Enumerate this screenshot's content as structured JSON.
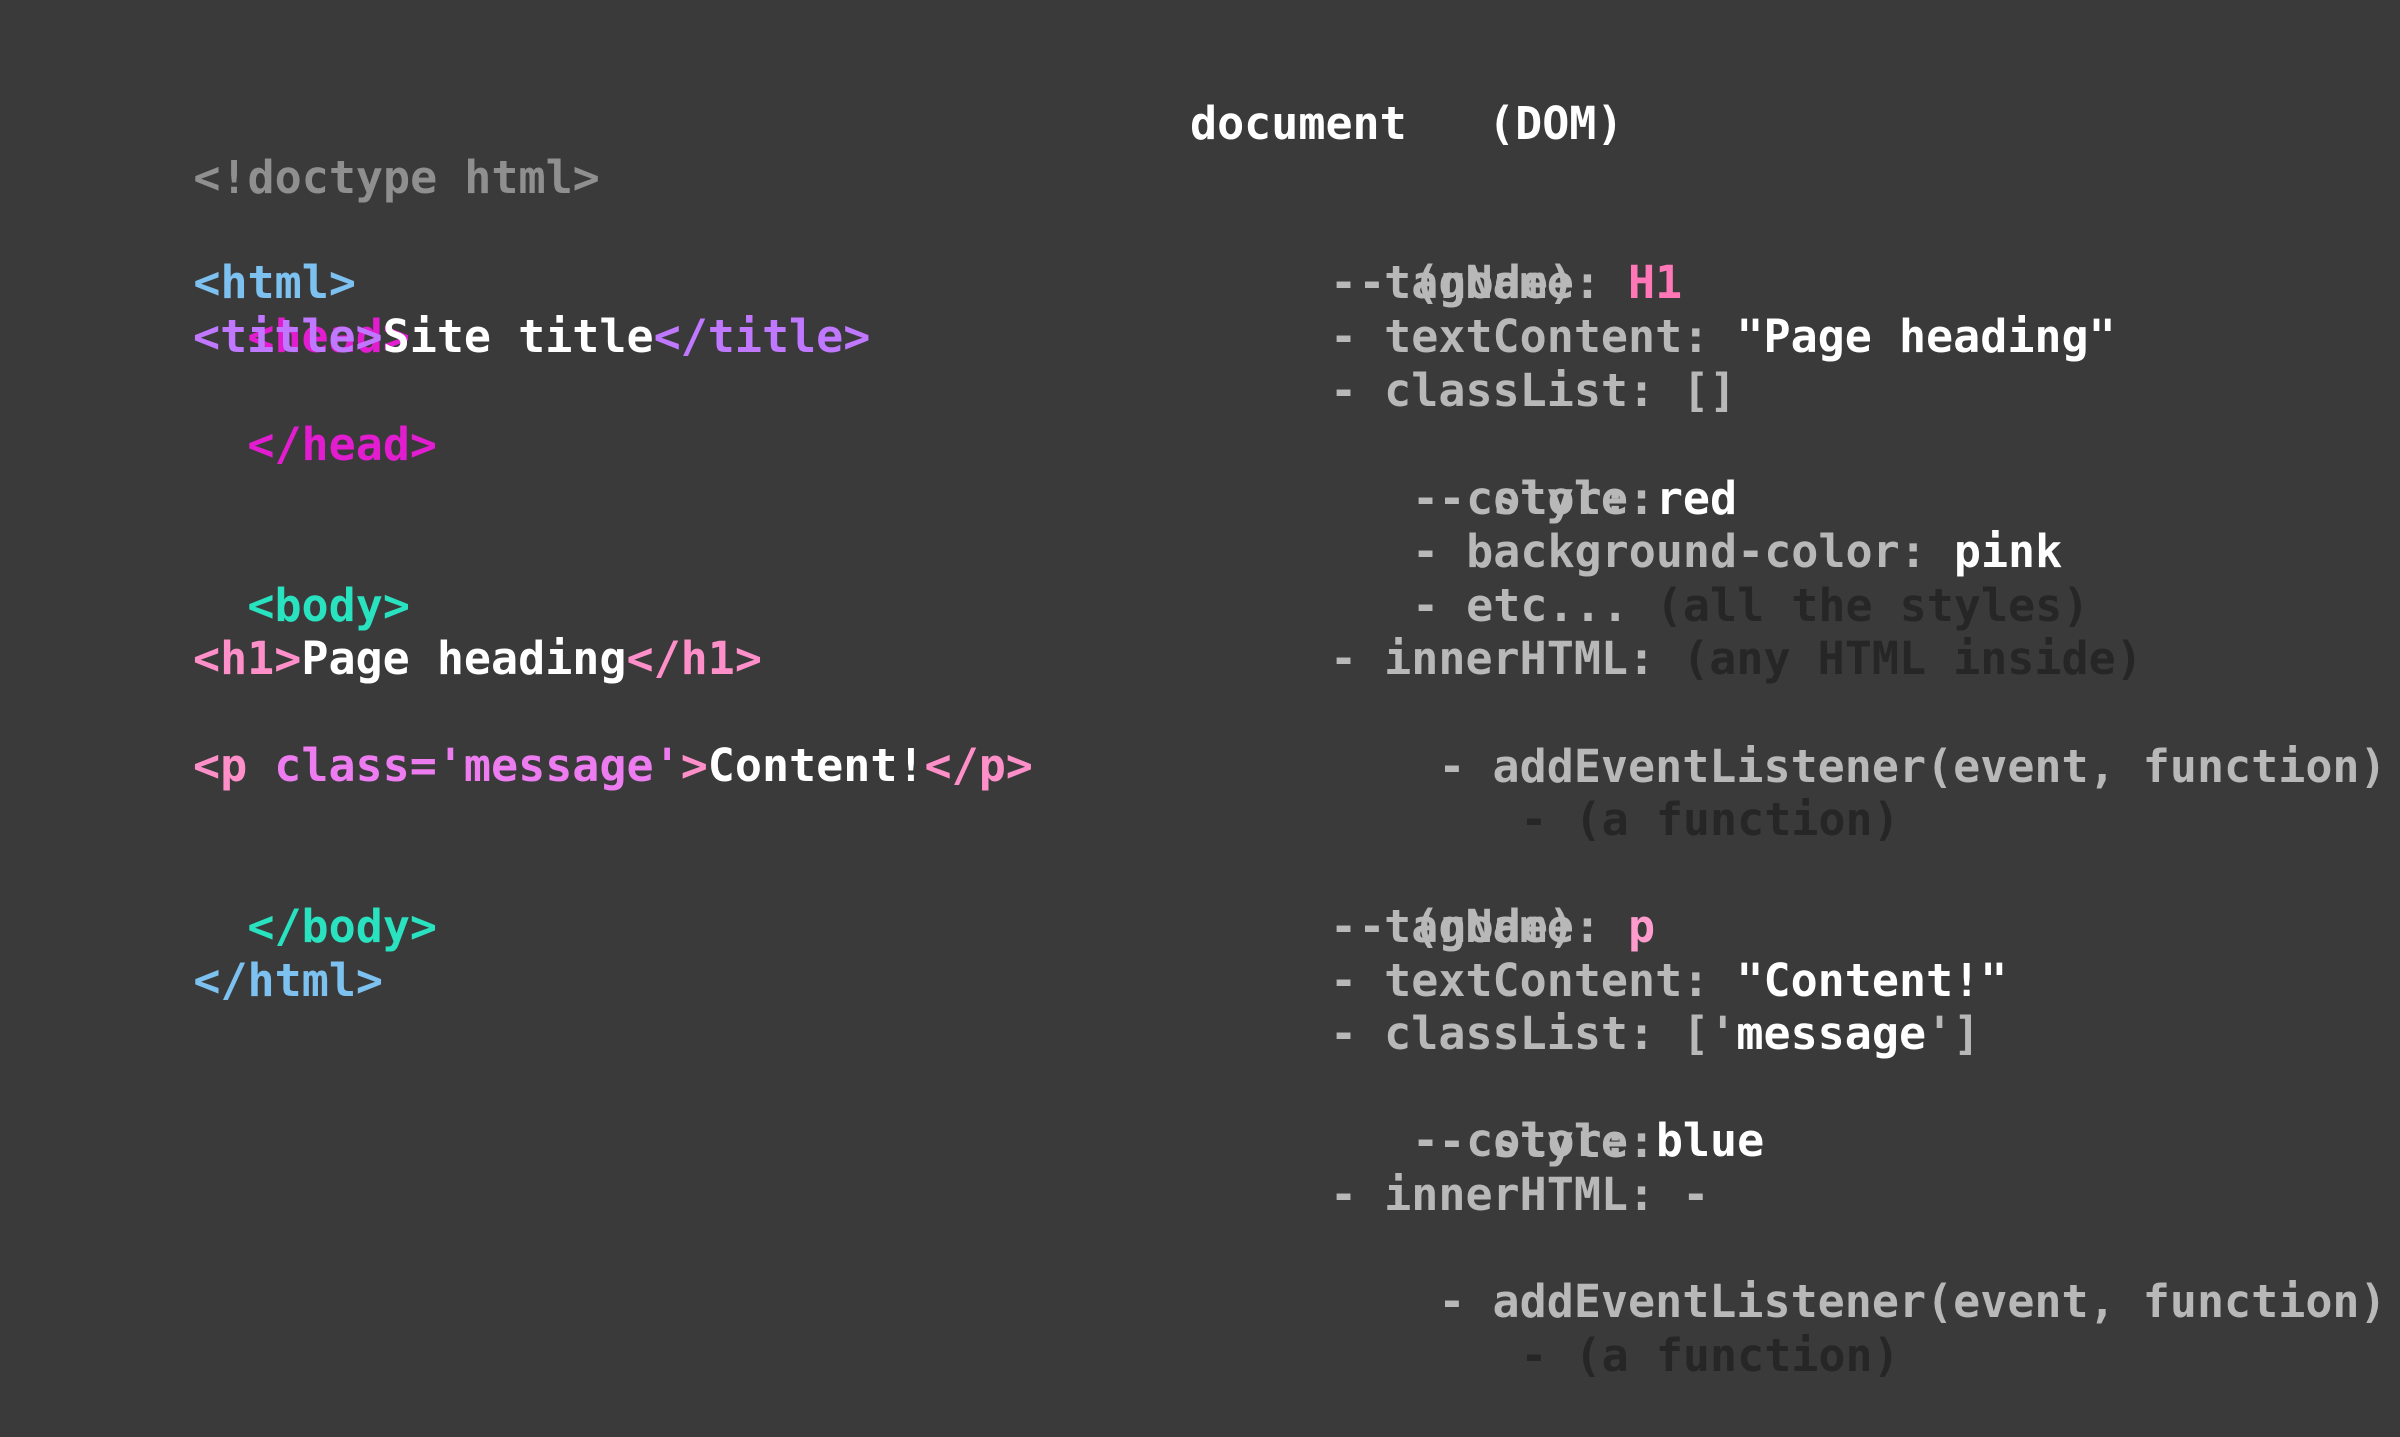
{
  "html_source": {
    "doctype": "<!doctype html>",
    "html_open": "<html>",
    "head_open": "<head>",
    "title_open": "<title>",
    "title_text": "Site title",
    "title_close": "</title>",
    "head_close": "</head>",
    "body_open": "<body>",
    "h1_open": "<h1>",
    "h1_text": "Page heading",
    "h1_close": "</h1>",
    "p_open_start": "<p ",
    "p_attr": "class=",
    "p_attr_value": "'message'",
    "p_open_end": ">",
    "p_text": "Content!",
    "p_close": "</p>",
    "body_close": "</body>",
    "html_close": "</html>"
  },
  "dom": {
    "title": "document",
    "title_note": "(DOM)",
    "nodes": [
      {
        "node_label": "- (node)",
        "tagName_key": "- tagName: ",
        "tagName_value": "H1",
        "textContent_key": "- textContent: ",
        "textContent_value": "\"Page heading\"",
        "classList_key": "- classList: ",
        "classList_value": "[]",
        "style_key": "- style:",
        "style_items": [
          {
            "key": "- color: ",
            "value": "red"
          },
          {
            "key": "- background-color: ",
            "value": "pink"
          }
        ],
        "style_etc_key": "- etc... ",
        "style_etc_note": "(all the styles)",
        "innerHTML_key": "- innerHTML: ",
        "innerHTML_value": "(any HTML inside)",
        "listener": "- addEventListener(event, function)",
        "listener_note": "- (a function)"
      },
      {
        "node_label": "- (node)",
        "tagName_key": "- tagName: ",
        "tagName_value": "p",
        "textContent_key": "- textContent: ",
        "textContent_value": "\"Content!\"",
        "classList_key": "- classList: ",
        "classList_open": "['",
        "classList_value": "message",
        "classList_close": "']",
        "style_key": "- style:",
        "style_items": [
          {
            "key": "- color: ",
            "value": "blue"
          }
        ],
        "innerHTML_key": "- innerHTML: ",
        "innerHTML_value": "-",
        "listener": "- addEventListener(event, function)",
        "listener_note": "- (a function)"
      }
    ]
  }
}
